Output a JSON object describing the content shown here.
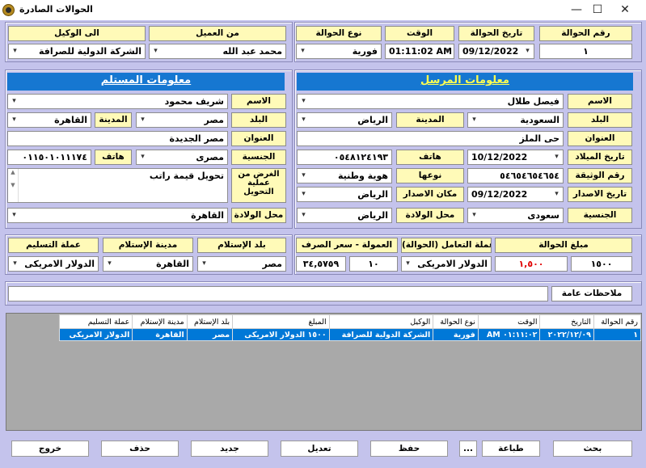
{
  "window": {
    "title": "الحوالات الصادرة",
    "minimize": "—",
    "maximize": "☐",
    "close": "✕"
  },
  "top": {
    "labels": {
      "number": "رقم الحوالة",
      "date": "تاريخ الحوالة",
      "time": "الوقت",
      "type": "نوع الحوالة",
      "client": "من العميل",
      "agent": "الى الوكيل"
    },
    "values": {
      "number": "١",
      "date": "09/12/2022",
      "time": "01:11:02 AM",
      "type": "فورية",
      "client": "محمد عبد الله",
      "agent": "الشركة الدولية للصرافة"
    }
  },
  "sender": {
    "header": "معلومات المرسل",
    "labels": {
      "name": "الاسم",
      "country": "البلد",
      "city": "المدينة",
      "address": "العنوان",
      "birth_date": "تاريخ الميلاد",
      "phone": "هاتف",
      "doc_number": "رقم الوثيقة",
      "doc_type": "نوعها",
      "issue_date": "تاريخ الاصدار",
      "issue_place": "مكان الاصدار",
      "nationality": "الجنسية",
      "birth_place": "محل الولادة"
    },
    "values": {
      "name": "فيصل طلال",
      "country": "السعودية",
      "city": "الرياض",
      "address": "حى الملز",
      "birth_date": "10/12/2022",
      "phone": "٠٥٤٨١٢٤١٩٣",
      "doc_number": "٥٤٦٥٤٦٥٤٦٥٤",
      "doc_type": "هوية وطنية",
      "issue_date": "09/12/2022",
      "issue_place": "الرياض",
      "nationality": "سعودى",
      "birth_place": "الرياض"
    }
  },
  "receiver": {
    "header": "معلومات المستلم",
    "labels": {
      "name": "الاسم",
      "country": "البلد",
      "city": "المدينة",
      "address": "العنوان",
      "nationality": "الجنسية",
      "phone": "هاتف",
      "purpose": "الغرض من عملية التحويل",
      "birth_place": "محل الولادة"
    },
    "values": {
      "name": "شريف محمود",
      "country": "مصر",
      "city": "القاهرة",
      "address": "مصر الجديدة",
      "nationality": "مصرى",
      "phone": "٠١١٥٠١٠١١١٧٤",
      "purpose": "تحويل قيمة راتب",
      "birth_place": "القاهرة"
    }
  },
  "amounts": {
    "labels": {
      "amount": "مبلغ الحوالة",
      "currency": "عملة التعامل (الحوالة)",
      "commission": "العمولة - سعر الصرف"
    },
    "values": {
      "amount": "١٥٠٠",
      "amount_red": "١,٥٠٠",
      "currency": "الدولار الامريكى",
      "commission": "١٠",
      "rate": "٣٤,٥٧٥٩"
    }
  },
  "receipt": {
    "labels": {
      "country": "بلد الإستلام",
      "city": "مدينة الإستلام",
      "currency": "عملة التسليم"
    },
    "values": {
      "country": "مصر",
      "city": "القاهرة",
      "currency": "الدولار الامريكى"
    }
  },
  "notes": {
    "label": "ملاحظات عامة",
    "value": ""
  },
  "table": {
    "columns": [
      "رقم الحوالة",
      "التاريخ",
      "الوقت",
      "نوع الحوالة",
      "الوكيل",
      "المبلغ",
      "بلد الإستلام",
      "مدينة الإستلام",
      "عملة التسليم"
    ],
    "rows": [
      [
        "١",
        "٢٠٢٢/١٢/٠٩",
        "٠١:١١:٠٢ AM",
        "فورية",
        "الشركة الدولية للصرافة",
        "١٥٠٠ الدولار الامريكى",
        "مصر",
        "القاهرة",
        "الدولار الامريكى"
      ]
    ]
  },
  "buttons": {
    "search": "بحث",
    "print": "طباعة",
    "more": "...",
    "save": "حفظ",
    "edit": "تعديل",
    "new": "جديد",
    "delete": "حذف",
    "exit": "خروج"
  },
  "icons": {
    "app": "app-logo-icon",
    "dropdown": "chevron-down-icon",
    "calendar": "calendar-icon"
  },
  "colors": {
    "background": "#c4c3ec",
    "label": "#fffab8",
    "header": "#1677d1",
    "selected_row": "#0078d7",
    "amount_red": "#e00000"
  }
}
